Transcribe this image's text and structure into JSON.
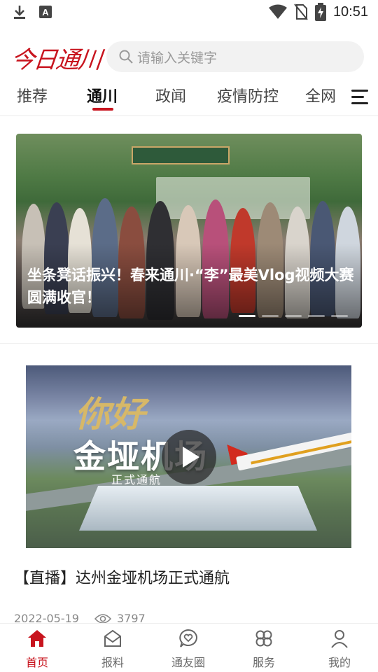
{
  "status_bar": {
    "time": "10:51",
    "icons": [
      "download-icon",
      "font-icon",
      "wifi-icon",
      "no-sim-icon",
      "battery-charging-icon"
    ]
  },
  "header": {
    "logo_text": "今日通川",
    "search_placeholder": "请输入关键字"
  },
  "tabs": [
    {
      "label": "推荐"
    },
    {
      "label": "通川",
      "active": true
    },
    {
      "label": "政闻"
    },
    {
      "label": "疫情防控"
    },
    {
      "label": "全网"
    }
  ],
  "banner": {
    "title": "坐条凳话振兴！春来通川·“李”最美Vlog视频大赛圆满收官！",
    "slide_count": 5,
    "active_slide": 1
  },
  "news_item": {
    "video_overlay_title": "你好",
    "video_overlay_name": "金垭机场",
    "video_overlay_sub": "正式通航",
    "title": "【直播】达州金垭机场正式通航",
    "date": "2022-05-19",
    "views": "3797"
  },
  "bottom_nav": [
    {
      "label": "首页",
      "icon": "home-icon",
      "active": true
    },
    {
      "label": "报料",
      "icon": "envelope-icon"
    },
    {
      "label": "通友圈",
      "icon": "chat-heart-icon"
    },
    {
      "label": "服务",
      "icon": "clover-icon"
    },
    {
      "label": "我的",
      "icon": "user-icon"
    }
  ],
  "colors": {
    "brand_red": "#c8141e",
    "search_bg": "#f2f2f2"
  }
}
